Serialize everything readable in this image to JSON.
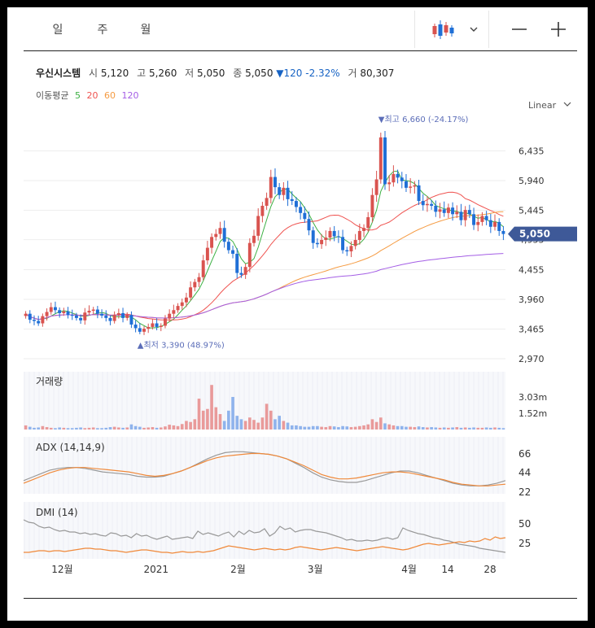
{
  "tabs": [
    {
      "label": "일",
      "active": true
    },
    {
      "label": "주",
      "active": false
    },
    {
      "label": "월",
      "active": false
    }
  ],
  "toolbar": {
    "chart_type_icon": "candlestick-icon",
    "dropdown_icon": "chevron-down-icon",
    "zoom_out_icon": "minus-icon",
    "zoom_in_icon": "plus-icon"
  },
  "quote": {
    "name": "우신시스템",
    "open_label": "시",
    "open": "5,120",
    "high_label": "고",
    "high": "5,260",
    "low_label": "저",
    "low": "5,050",
    "close_label": "종",
    "close": "5,050",
    "change": "▼120",
    "change_pct": "-2.32%",
    "volume_label": "거",
    "volume": "80,307"
  },
  "moving_average": {
    "label": "이동평균",
    "periods": [
      "5",
      "20",
      "60",
      "120"
    ],
    "colors": [
      "#3cb043",
      "#ef5350",
      "#f59b42",
      "#a45ee5"
    ]
  },
  "scale_label": "Linear",
  "colors": {
    "up": "#d9534f",
    "down": "#1f6fd6",
    "accent": "#3e5998",
    "adx": "#999999",
    "adx_signal": "#f0893a"
  },
  "chart_data": [
    {
      "type": "candlestick",
      "title": "",
      "ylim": [
        2970,
        6930
      ],
      "y_ticks": [
        "6,435",
        "5,940",
        "5,445",
        "4,955",
        "4,455",
        "3,960",
        "3,465",
        "2,970"
      ],
      "last_price_label": "5,050",
      "max_label": "▼최고 6,660 (-24.17%)",
      "min_label": "▲최저 3,390 (48.97%)",
      "x_labels": [
        "12월",
        "2021",
        "2월",
        "3월",
        "4월",
        "14",
        "28"
      ],
      "close": [
        3720,
        3620,
        3600,
        3560,
        3680,
        3750,
        3830,
        3780,
        3730,
        3760,
        3700,
        3690,
        3650,
        3610,
        3740,
        3770,
        3790,
        3720,
        3690,
        3650,
        3600,
        3700,
        3730,
        3650,
        3700,
        3540,
        3480,
        3420,
        3470,
        3500,
        3560,
        3500,
        3520,
        3640,
        3720,
        3780,
        3850,
        3910,
        3990,
        4160,
        4250,
        4330,
        4610,
        4820,
        5000,
        5050,
        5150,
        4920,
        4780,
        4720,
        4400,
        4370,
        4500,
        4900,
        5020,
        5350,
        5520,
        5650,
        6000,
        5830,
        5700,
        5820,
        5630,
        5600,
        5500,
        5400,
        5300,
        5110,
        4900,
        4880,
        4950,
        4990,
        5100,
        5010,
        5000,
        4780,
        4760,
        4850,
        4950,
        5100,
        5150,
        5330,
        5700,
        5960,
        6660,
        5880,
        5910,
        6050,
        5990,
        5930,
        5820,
        5840,
        5860,
        5600,
        5530,
        5550,
        5520,
        5420,
        5460,
        5400,
        5490,
        5380,
        5420,
        5280,
        5450,
        5380,
        5200,
        5250,
        5350,
        5280,
        5170,
        5250,
        5100,
        5050
      ],
      "volume": [
        0.12,
        0.08,
        0.05,
        0.06,
        0.1,
        0.07,
        0.05,
        0.04,
        0.06,
        0.05,
        0.04,
        0.04,
        0.05,
        0.06,
        0.04,
        0.05,
        0.06,
        0.04,
        0.04,
        0.05,
        0.07,
        0.08,
        0.06,
        0.05,
        0.06,
        0.15,
        0.1,
        0.08,
        0.05,
        0.06,
        0.07,
        0.05,
        0.06,
        0.09,
        0.14,
        0.12,
        0.1,
        0.16,
        0.25,
        0.22,
        0.3,
        0.9,
        0.55,
        0.6,
        1.3,
        0.65,
        0.45,
        0.25,
        0.55,
        0.95,
        0.4,
        0.3,
        0.25,
        0.35,
        0.28,
        0.2,
        0.35,
        0.75,
        0.55,
        0.3,
        0.4,
        0.25,
        0.2,
        0.12,
        0.12,
        0.1,
        0.08,
        0.08,
        0.1,
        0.1,
        0.08,
        0.07,
        0.1,
        0.09,
        0.07,
        0.1,
        0.09,
        0.07,
        0.08,
        0.1,
        0.12,
        0.15,
        0.3,
        0.22,
        0.35,
        0.18,
        0.15,
        0.12,
        0.1,
        0.1,
        0.08,
        0.08,
        0.07,
        0.09,
        0.07,
        0.06,
        0.07,
        0.06,
        0.05,
        0.06,
        0.05,
        0.06,
        0.07,
        0.05,
        0.06,
        0.05,
        0.06,
        0.05,
        0.05,
        0.06,
        0.05,
        0.06,
        0.05,
        0.04
      ]
    },
    {
      "type": "bar",
      "title": "거래량",
      "y_ticks": [
        "3.03m",
        "1.52m"
      ]
    },
    {
      "type": "line",
      "title": "ADX (14,14,9)",
      "y_ticks": [
        "66",
        "44",
        "22"
      ],
      "ylim": [
        10,
        75
      ],
      "series": [
        {
          "values": [
            25,
            29,
            33,
            37,
            39,
            40,
            40,
            39,
            37,
            35,
            34,
            33,
            32,
            30,
            29,
            29,
            30,
            33,
            36,
            40,
            45,
            50,
            54,
            57,
            58,
            58,
            57,
            56,
            55,
            53,
            50,
            45,
            40,
            34,
            29,
            26,
            24,
            23,
            23,
            25,
            28,
            31,
            34,
            36,
            36,
            34,
            31,
            28,
            25,
            22,
            20,
            19,
            19,
            20,
            22,
            25
          ]
        },
        {
          "values": [
            22,
            26,
            30,
            34,
            37,
            39,
            40,
            40,
            39,
            38,
            37,
            36,
            35,
            33,
            31,
            30,
            31,
            33,
            36,
            40,
            44,
            48,
            51,
            53,
            54,
            55,
            56,
            56,
            55,
            53,
            50,
            46,
            42,
            37,
            32,
            29,
            27,
            27,
            28,
            30,
            32,
            34,
            35,
            35,
            34,
            32,
            30,
            28,
            26,
            23,
            21,
            20,
            19,
            19,
            20,
            21
          ]
        }
      ]
    },
    {
      "type": "line",
      "title": "DMI (14)",
      "y_ticks": [
        "50",
        "25"
      ],
      "ylim": [
        0,
        70
      ],
      "series": [
        {
          "values": [
            48,
            45,
            44,
            40,
            38,
            39,
            36,
            34,
            35,
            33,
            33,
            31,
            32,
            30,
            31,
            29,
            28,
            32,
            31,
            28,
            29,
            26,
            31,
            28,
            29,
            26,
            24,
            26,
            28,
            24,
            25,
            26,
            27,
            25,
            34,
            30,
            32,
            30,
            28,
            31,
            33,
            27,
            34,
            30,
            35,
            32,
            33,
            37,
            28,
            32,
            40,
            36,
            38,
            33,
            35,
            36,
            36,
            34,
            33,
            32,
            30,
            28,
            26,
            23,
            24,
            22,
            22,
            23,
            22,
            23,
            25,
            26,
            24,
            26,
            38,
            35,
            33,
            31,
            30,
            28,
            26,
            25,
            23,
            22,
            20,
            18,
            17,
            16,
            15,
            13,
            12,
            11,
            10,
            9,
            8
          ]
        },
        {
          "values": [
            8,
            8,
            9,
            10,
            10,
            9,
            10,
            10,
            9,
            10,
            11,
            12,
            13,
            13,
            12,
            12,
            11,
            10,
            10,
            9,
            8,
            9,
            10,
            11,
            11,
            10,
            9,
            8,
            8,
            7,
            8,
            9,
            8,
            8,
            9,
            8,
            9,
            10,
            12,
            14,
            16,
            15,
            14,
            13,
            12,
            11,
            12,
            13,
            12,
            11,
            12,
            11,
            12,
            14,
            15,
            14,
            13,
            12,
            11,
            12,
            13,
            14,
            13,
            12,
            11,
            10,
            11,
            12,
            13,
            14,
            15,
            14,
            13,
            12,
            11,
            12,
            14,
            16,
            18,
            19,
            18,
            17,
            18,
            19,
            20,
            21,
            20,
            22,
            21,
            22,
            25,
            23,
            27,
            25,
            26
          ]
        }
      ]
    }
  ]
}
